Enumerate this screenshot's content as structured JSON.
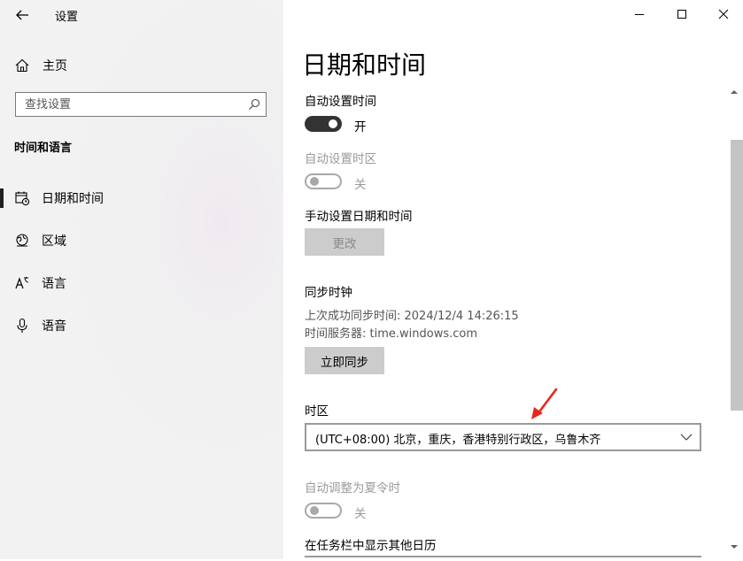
{
  "window": {
    "title": "设置"
  },
  "sidebar": {
    "home_label": "主页",
    "search_placeholder": "查找设置",
    "section_title": "时间和语言",
    "items": [
      {
        "label": "日期和时间",
        "icon": "calendar-clock-icon",
        "active": true
      },
      {
        "label": "区域",
        "icon": "globe-icon",
        "active": false
      },
      {
        "label": "语言",
        "icon": "language-icon",
        "active": false
      },
      {
        "label": "语音",
        "icon": "microphone-icon",
        "active": false
      }
    ]
  },
  "main": {
    "title": "日期和时间",
    "auto_time": {
      "label": "自动设置时间",
      "state": "开",
      "on": true
    },
    "auto_timezone": {
      "label": "自动设置时区",
      "state": "关",
      "on": false,
      "disabled": true
    },
    "manual": {
      "label": "手动设置日期和时间",
      "button": "更改",
      "disabled": true
    },
    "sync": {
      "label": "同步时钟",
      "last_sync": "上次成功同步时间: 2024/12/4 14:26:15",
      "server": "时间服务器: time.windows.com",
      "button": "立即同步"
    },
    "timezone": {
      "label": "时区",
      "value": "(UTC+08:00) 北京，重庆，香港特别行政区，乌鲁木齐"
    },
    "dst": {
      "label": "自动调整为夏令时",
      "state": "关",
      "on": false,
      "disabled": true
    },
    "extra_calendar": {
      "label": "在任务栏中显示其他日历"
    }
  },
  "colors": {
    "annotation_arrow": "#e8261c",
    "toggle_on": "#333333",
    "button_bg": "#cccccc"
  }
}
